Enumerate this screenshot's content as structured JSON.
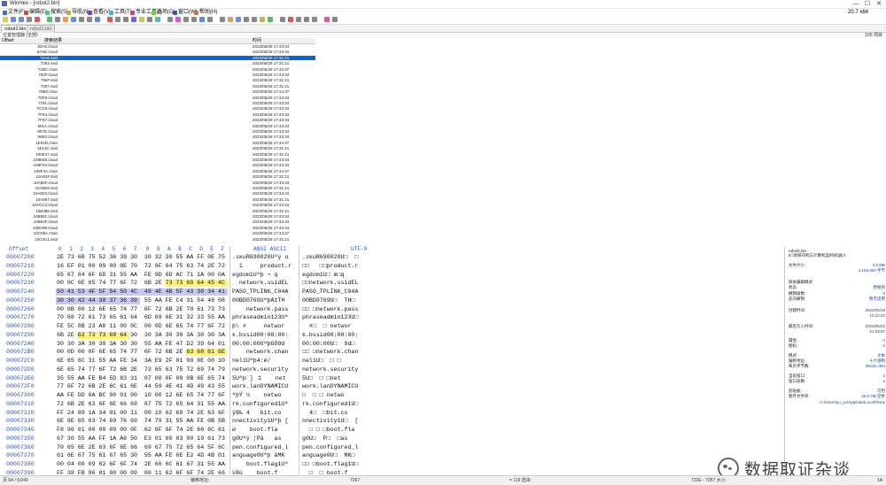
{
  "window": {
    "app_name": "WinHex",
    "doc_title": "[robot2.bin]",
    "buttons": [
      "—",
      "☐",
      "✕"
    ]
  },
  "menu": {
    "items": [
      "文件(F)",
      "编辑(E)",
      "搜索(S)",
      "导航(N)",
      "查看(V)",
      "工具(T)",
      "专业工具(I)",
      "选项(O)",
      "窗口(W)",
      "帮助(H)"
    ],
    "zoom": "20.7 x64"
  },
  "tabs": [
    "robot2.bin",
    "robot1.bin"
  ],
  "filter_bar": {
    "label": "位置管理器 (全部)",
    "count": "105 项目"
  },
  "list_header": {
    "offset": "Offset",
    "name": "搜索结果",
    "time": "时间"
  },
  "file_list": [
    {
      "name": "60A0.cloud",
      "time": "2023/05/29  17:43:34"
    },
    {
      "name": "6A5D.cloud",
      "time": "2023/05/29  17:43:34"
    },
    {
      "name": "72A6.ssid",
      "time": "2023/05/29  17:31:21",
      "selected": true
    },
    {
      "name": "7293.ssid",
      "time": "2023/05/29  17:31:21"
    },
    {
      "name": "72BC.chan",
      "time": "2023/05/29  17:44:37"
    },
    {
      "name": "753F.cloud",
      "time": "2023/05/29  17:43:34"
    },
    {
      "name": "755F.ssid",
      "time": "2023/05/29  17:31:21"
    },
    {
      "name": "7587.ssid",
      "time": "2023/05/29  17:31:21"
    },
    {
      "name": "75B0.chan",
      "time": "2023/05/29  17:44:37"
    },
    {
      "name": "76F8.cloud",
      "time": "2023/05/29  17:43:34"
    },
    {
      "name": "7791.cloud",
      "time": "2023/05/29  17:43:34"
    },
    {
      "name": "7CC9.cloud",
      "time": "2023/05/29  17:43:34"
    },
    {
      "name": "7F54.cloud",
      "time": "2023/05/29  17:43:34"
    },
    {
      "name": "7F67.cloud",
      "time": "2023/05/29  17:43:34"
    },
    {
      "name": "801A.cloud",
      "time": "2023/05/29  17:43:34"
    },
    {
      "name": "807D.cloud",
      "time": "2023/05/29  17:43:34"
    },
    {
      "name": "80E0.cloud",
      "time": "2023/05/29  17:43:34"
    },
    {
      "name": "1E01D.chan",
      "time": "2023/05/29  17:44:37"
    },
    {
      "name": "1E14C.ssid",
      "time": "2023/05/29  17:31:21"
    },
    {
      "name": "108E47.ssid",
      "time": "2023/05/29  17:31:21"
    },
    {
      "name": "108E68.cloud",
      "time": "2023/05/29  17:43:34"
    },
    {
      "name": "108F04.cloud",
      "time": "2023/05/29  17:43:34"
    },
    {
      "name": "108F4A.chan",
      "time": "2023/05/29  17:44:37"
    },
    {
      "name": "10A81F.ssid",
      "time": "2023/05/29  17:31:21"
    },
    {
      "name": "10A86F.cloud",
      "time": "2023/05/29  17:43:34"
    },
    {
      "name": "10A8D8.ssid",
      "time": "2023/05/29  17:31:21"
    },
    {
      "name": "10A923.cloud",
      "time": "2023/05/29  17:43:34"
    },
    {
      "name": "10A957.ssid",
      "time": "2023/05/29  17:31:21"
    },
    {
      "name": "10ACC2.cloud",
      "time": "2023/05/29  17:43:34"
    },
    {
      "name": "10B388.ssid",
      "time": "2023/05/29  17:31:21"
    },
    {
      "name": "10B591.cloud",
      "time": "2023/05/29  17:43:34"
    },
    {
      "name": "10B64F.cloud",
      "time": "2023/05/29  17:43:34"
    },
    {
      "name": "10BA99.cloud",
      "time": "2023/05/29  17:43:34"
    },
    {
      "name": "10C08A.chan",
      "time": "2023/05/29  17:44:37"
    },
    {
      "name": "10C0C1.ssid",
      "time": "2023/05/29  17:31:21"
    }
  ],
  "hex_header": {
    "offset": "Offset",
    "cols": [
      "0",
      "1",
      "2",
      "3",
      "4",
      "5",
      "6",
      "7",
      "8",
      "9",
      "A",
      "B",
      "C",
      "D",
      "E",
      "F"
    ],
    "ansi": "ANSI ASCII",
    "utf": "UTF-8"
  },
  "hex_rows": [
    {
      "off": "00007200",
      "hex": "2E 73 6B 75 52 36 39 30  30 32 30 55 AA FF 0E 75",
      "ansi": ".skuR690020Uªÿ u",
      "utf": ".skuR690020U□  □"
    },
    {
      "off": "00007210",
      "hex": "16 EF 01 00 09 00 0E 70  72 6F 64 75 63 74 2E 72",
      "ansi": "  ï     product.r",
      "utf": "□□   □□product.r"
    },
    {
      "off": "00007220",
      "hex": "65 67 64 6F 6D 31 55 AA  FE 9D 6D AC 71 1A 00 0A",
      "ansi": "egdom1Uªþ ¬ q",
      "utf": "egdom1U□ m□q"
    },
    {
      "off": "00007230",
      "hex": "00 0C 6E 65 74 77 6F 72  6B 2E 73 73 69 64 45 4C",
      "ansi": "  network.ssidEL",
      "utf": "□□network.ssidEL"
    },
    {
      "off": "00007240",
      "hex": "50 41 53 4F 5F 54 50 4C  49 4E 4B 5F 43 30 34 41",
      "ansi": "PASO_TPLINK_C04A",
      "utf": "PASO_TPLINK_C04A"
    },
    {
      "off": "00007250",
      "hex": "30 30 42 44 30 37 36 39  55 AA FE C4 31 54 48 08",
      "ansi": "00BD0769UªþÄ1TH",
      "utf": "00BD0769U□  TH□"
    },
    {
      "off": "00007260",
      "hex": "00 0B 00 12 6E 65 74 77  6F 72 6B 2E 70 61 73 73",
      "ansi": "    network.pass",
      "utf": "□□ □network.pass"
    },
    {
      "off": "00007270",
      "hex": "70 68 72 61 73 65 61 64  6D 69 6E 31 32 33 55 AA",
      "ansi": "phraseadmin123Uª",
      "utf": "phraseadmin123U□"
    },
    {
      "off": "00007280",
      "hex": "FE 5C 0B 23 A0 11 00 0C  00 0D 6E 65 74 77 6F 72",
      "ansi": "þ\\ #     networ",
      "utf": "  #□  □ networ"
    },
    {
      "off": "00007290",
      "hex": "6B 2E 62 73 73 69 64 30  30 3A 30 30 3A 30 30 3A",
      "ansi": "k.bssid00:00:00:",
      "utf": "k.bssid00:00:00:"
    },
    {
      "off": "000072A0",
      "hex": "30 30 3A 30 30 3A 30 30  55 AA FE 47 D2 39 64 01",
      "ansi": "00:00:00UªþGÒ9d",
      "utf": "00:00:00U□  9d□"
    },
    {
      "off": "000072B0",
      "hex": "00 0D 00 0F 6E 65 74 77  6F 72 6B 2E 63 68 61 6E",
      "ansi": "    network.chan",
      "utf": "□□ □network.chan"
    },
    {
      "off": "000072C0",
      "hex": "6E 65 6C 31 55 AA FE 34  3A E9 2F 01 00 0E 00 10",
      "ansi": "nel1Uªþ4:é/",
      "utf": "nel1U□  □ □"
    },
    {
      "off": "000072D0",
      "hex": "6E 65 74 77 6F 72 6B 2E  73 65 63 75 72 69 74 79",
      "ansi": "network.security",
      "utf": "network.security"
    },
    {
      "off": "000072E0",
      "hex": "35 55 AA FE B4 5D 83 31  07 00 0F 00 0B 6E 65 74",
      "ansi": "5Uªþ´]1    net",
      "utf": "5U□  □ □net"
    },
    {
      "off": "000072F0",
      "hex": "77 6F 72 6B 2E 6C 61 6E  44 59 4E 41 4D 49 43 55",
      "ansi": "work.lanDYNAMICU",
      "utf": "work.lanDYNAMICU"
    },
    {
      "off": "00007300",
      "hex": "AA FE DD 0A BC 00 01 00  10 00 12 6E 65 74 77 6F",
      "ansi": "ªþÝ ¼    netwo",
      "utf": "□  □ □ netwo"
    },
    {
      "off": "00007310",
      "hex": "72 6B 2E 63 6F 6E 66 69  67 75 72 65 64 31 55 AA",
      "ansi": "rk.configured1Uª",
      "utf": "rk.configured1U□"
    },
    {
      "off": "00007320",
      "hex": "FF 24 89 1A 34 01 00 11  00 10 62 69 74 2E 63 6F",
      "ansi": "ÿ$‰ 4   bit.co",
      "utf": "  4□  □bit.co"
    },
    {
      "off": "00007330",
      "hex": "6E 6E 65 63 74 69 76 69  74 79 31 55 AA FE 0B 5B",
      "ansi": "nnectivity1Uªþ [",
      "utf": "nnectivity1U□  ["
    },
    {
      "off": "00007340",
      "hex": "F8 96 01 00 00 09 00 0F  62 6F 6F 74 2E 66 6C 61",
      "ansi": "ø    boot.fla",
      "utf": "  □ □ □boot.fla"
    },
    {
      "off": "00007350",
      "hex": "67 30 55 AA FF 1A A6 50  E3 01 00 03 00 19 61 73",
      "ansi": "g0Uªÿ ¦Pã   as",
      "utf": "g0U□  P□  □as"
    },
    {
      "off": "00007360",
      "hex": "70 65 6E 2E 63 6F 6E 66  69 67 75 72 65 64 5F 6C",
      "ansi": "pen.configured_l",
      "utf": "pen.configured_l"
    },
    {
      "off": "00007370",
      "hex": "61 6E 67 75 61 67 65 30  55 AA FE 0E E2 4D 4B 01",
      "ansi": "anguage0Uªþ âMK",
      "utf": "anguage0U□  MK□"
    },
    {
      "off": "00007380",
      "hex": "00 04 00 09 62 6F 6F 74  2E 66 6C 61 67 31 55 AA",
      "ansi": "    boot.flag1Uª",
      "utf": "□□ □boot.flag1U□"
    },
    {
      "off": "00007390",
      "hex": "FF 38 FB 96 01 00 00 09  00 11 62 6F 6F 74 2E 66",
      "ansi": "ÿ8û    boot.f",
      "utf": "  □  □ boot.f"
    },
    {
      "off": "000073A0",
      "hex": "6C 61 67 30 55 AA FF 0B  3B FB 96 01 00 04 00 09",
      "ansi": "lag0Uªÿ ;û",
      "utf": "lag0U□  □ □"
    },
    {
      "off": "000073B0",
      "hex": "62 6F 6F 74 2E 66 6C 61  67 30 55 AA FF 79 65 0F",
      "ansi": "boot.flag0Uªÿye",
      "utf": "boot.flag0U□ ye"
    },
    {
      "off": "000073C0",
      "hex": "61 73 70 65 6E 2E 72 62  74 5F 70",
      "ansi": "aspen.rbt_p",
      "utf": "□□aspen.rbt_p"
    }
  ],
  "right_panel": {
    "file_name": "robot2.bin",
    "path": "E:\\地铁司机与计算机案例\\机器人",
    "rows": [
      {
        "label": "文件大小:",
        "value": "4.0 MB"
      },
      {
        "label": "",
        "value": "4,194,304 字节"
      },
      {
        "label": "缺省编辑模式",
        "value": ""
      },
      {
        "label": "状态:",
        "value": "原始的"
      },
      {
        "label": "撤销级数:",
        "value": "0"
      },
      {
        "label": "反向撤销:",
        "value": "暂无适用"
      },
      {
        "label": "创建时间:",
        "value": "2023/05/18"
      },
      {
        "label": "",
        "value": "10:22:22"
      },
      {
        "label": "最后写入时间:",
        "value": "2023/05/02"
      },
      {
        "label": "",
        "value": "21:03:57"
      },
      {
        "label": "属性:",
        "value": "A"
      },
      {
        "label": "图标:",
        "value": "0"
      },
      {
        "label": "模式:",
        "value": "文本"
      },
      {
        "label": "偏移地址:",
        "value": "十六进制"
      },
      {
        "label": "每页字节数:",
        "value": "29x16=464"
      },
      {
        "label": "当前窗口:",
        "value": "2"
      },
      {
        "label": "窗口总数:",
        "value": "2"
      },
      {
        "label": "剪贴板:",
        "value": "可用"
      },
      {
        "label": "暂存文件夹:",
        "value": "25.5 GB 空余"
      },
      {
        "label": "",
        "value": "C:\\Users\\yu_yu\\AppData\\Local\\Temp"
      }
    ]
  },
  "watermark": "数据取证杂谈",
  "status": {
    "page": "页 64 / 9,040",
    "mode": "偏移地址:",
    "offset_val": "7267",
    "sel": "= 119  选块:",
    "range": "723E - 7257  大小:",
    "size": "1A"
  },
  "colors": {
    "selected_row": "#0a64d8",
    "hex_highlight_yellow": "#fff27a",
    "hex_highlight_purple": "#c7c9ee",
    "offset_blue": "#2a56c6"
  }
}
